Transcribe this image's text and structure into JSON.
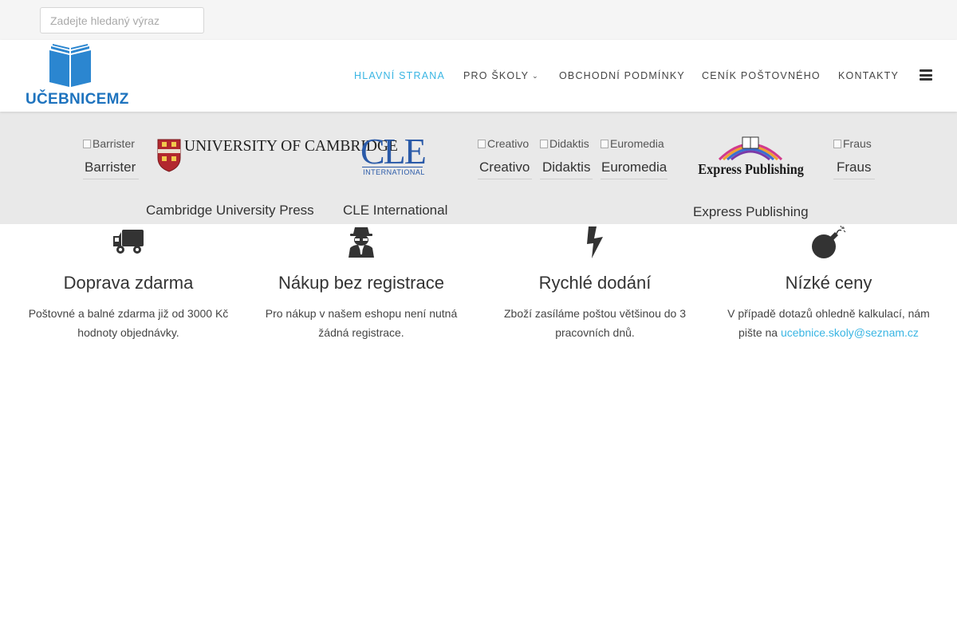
{
  "search": {
    "placeholder": "Zadejte hledaný výraz"
  },
  "logo": {
    "text": "UČEBNICEMZ"
  },
  "nav": {
    "items": [
      {
        "label": "HLAVNÍ STRANA",
        "active": true
      },
      {
        "label": "PRO ŠKOLY",
        "has_dropdown": true
      },
      {
        "label": "OBCHODNÍ PODMÍNKY"
      },
      {
        "label": "CENÍK POŠTOVNÉHO"
      },
      {
        "label": "KONTAKTY"
      }
    ],
    "menu_icon": "hamburger-icon",
    "active_color": "#39b5e3"
  },
  "brands": [
    {
      "alt": "Barrister",
      "name": "Barrister"
    },
    {
      "logo_text": "UNIVERSITY OF CAMBRIDGE",
      "name": "Cambridge University Press"
    },
    {
      "logo_text": "CLE",
      "logo_subtext": "INTERNATIONAL",
      "name": "CLE International"
    },
    {
      "alt": "Creativo",
      "name": "Creativo"
    },
    {
      "alt": "Didaktis",
      "name": "Didaktis"
    },
    {
      "alt": "Euromedia",
      "name": "Euromedia"
    },
    {
      "logo_text": "Express Publishing",
      "name": "Express Publishing"
    },
    {
      "alt": "Fraus",
      "name": "Fraus"
    }
  ],
  "features": [
    {
      "icon": "truck-icon",
      "title": "Doprava zdarma",
      "text": "Poštovné a balné zdarma již od 3000 Kč hodnoty objednávky."
    },
    {
      "icon": "user-secret-icon",
      "title": "Nákup bez registrace",
      "text": "Pro nákup v našem eshopu není nutná žádná registrace."
    },
    {
      "icon": "bolt-icon",
      "title": "Rychlé dodání",
      "text": "Zboží zasíláme poštou většinou do 3 pracovních dnů."
    },
    {
      "icon": "bomb-icon",
      "title": "Nízké ceny",
      "text_before": "V případě dotazů ohledně kalkulací, nám pište na ",
      "email": "ucebnice.skoly@seznam.cz"
    }
  ],
  "colors": {
    "accent": "#39b5e3",
    "logo_blue": "#1e73be",
    "brand_bar_bg": "#e9e9e9"
  }
}
